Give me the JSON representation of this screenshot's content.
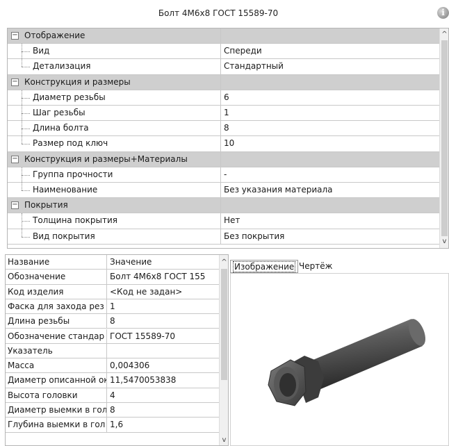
{
  "header": {
    "title": "Болт 4М6х8 ГОСТ 15589-70",
    "info_icon": "info-icon"
  },
  "property_grid": {
    "rows": [
      {
        "type": "category",
        "label": "Отображение",
        "value": ""
      },
      {
        "type": "prop",
        "label": "Вид",
        "value": "Спереди"
      },
      {
        "type": "prop",
        "label": "Детализация",
        "value": "Стандартный",
        "last": true
      },
      {
        "type": "category",
        "label": "Конструкция и размеры",
        "value": ""
      },
      {
        "type": "prop",
        "label": "Диаметр резьбы",
        "value": "6"
      },
      {
        "type": "prop",
        "label": "Шаг резьбы",
        "value": "1"
      },
      {
        "type": "prop",
        "label": "Длина болта",
        "value": "8"
      },
      {
        "type": "prop",
        "label": "Размер под ключ",
        "value": "10",
        "last": true
      },
      {
        "type": "category",
        "label": "Конструкция и размеры+Материалы",
        "value": ""
      },
      {
        "type": "prop",
        "label": "Группа прочности",
        "value": "-"
      },
      {
        "type": "prop",
        "label": "Наименование",
        "value": "Без указания материала",
        "last": true
      },
      {
        "type": "category",
        "label": "Покрытия",
        "value": ""
      },
      {
        "type": "prop",
        "label": "Толщина покрытия",
        "value": "Нет"
      },
      {
        "type": "prop",
        "label": "Вид покрытия",
        "value": "Без покрытия",
        "last": true
      }
    ],
    "scroll_up": "^",
    "scroll_down": "v"
  },
  "parameters_table": {
    "headers": [
      "Название",
      "Значение"
    ],
    "rows": [
      [
        "Обозначение",
        "Болт 4М6х8 ГОСТ 155"
      ],
      [
        "Код изделия",
        "<Код не задан>"
      ],
      [
        "Фаска для захода рез",
        "1"
      ],
      [
        "Длина резьбы",
        "8"
      ],
      [
        "Обозначение стандар",
        "ГОСТ 15589-70"
      ],
      [
        "Указатель",
        ""
      ],
      [
        "Масса",
        "0,004306"
      ],
      [
        "Диаметр описанной ок",
        "11,5470053838"
      ],
      [
        "Высота головки",
        "4"
      ],
      [
        "Диаметр выемки в гол",
        "8"
      ],
      [
        "Глубина выемки в гол",
        "1,6"
      ]
    ],
    "scroll_up": "^",
    "scroll_down": "v"
  },
  "preview": {
    "tabs": [
      {
        "label": "Изображение",
        "active": true
      },
      {
        "label": "Чертёж",
        "active": false
      }
    ]
  }
}
